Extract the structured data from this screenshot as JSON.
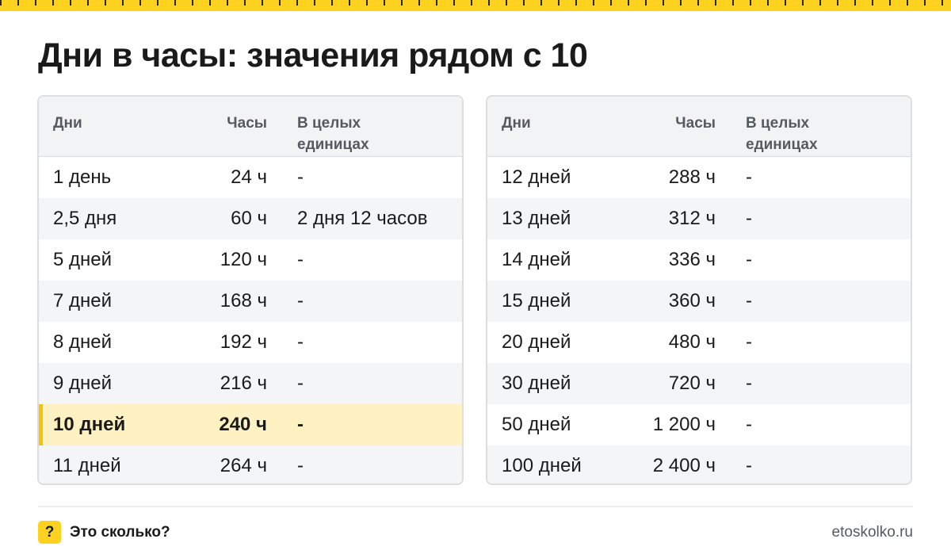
{
  "title": "Дни в часы: значения рядом с 10",
  "columns": {
    "days": "Дни",
    "hours": "Часы",
    "units_line1": "В целых",
    "units_line2": "единицах"
  },
  "left_rows": [
    {
      "days": "1 день",
      "hours": "24 ч",
      "units": "-"
    },
    {
      "days": "2,5 дня",
      "hours": "60 ч",
      "units": "2 дня 12 часов"
    },
    {
      "days": "5 дней",
      "hours": "120 ч",
      "units": "-"
    },
    {
      "days": "7 дней",
      "hours": "168 ч",
      "units": "-"
    },
    {
      "days": "8 дней",
      "hours": "192 ч",
      "units": "-"
    },
    {
      "days": "9 дней",
      "hours": "216 ч",
      "units": "-"
    },
    {
      "days": "10 дней",
      "hours": "240 ч",
      "units": "-"
    },
    {
      "days": "11 дней",
      "hours": "264 ч",
      "units": "-"
    }
  ],
  "right_rows": [
    {
      "days": "12 дней",
      "hours": "288 ч",
      "units": "-"
    },
    {
      "days": "13 дней",
      "hours": "312 ч",
      "units": "-"
    },
    {
      "days": "14 дней",
      "hours": "336 ч",
      "units": "-"
    },
    {
      "days": "15 дней",
      "hours": "360 ч",
      "units": "-"
    },
    {
      "days": "20 дней",
      "hours": "480 ч",
      "units": "-"
    },
    {
      "days": "30 дней",
      "hours": "720 ч",
      "units": "-"
    },
    {
      "days": "50 дней",
      "hours": "1 200 ч",
      "units": "-"
    },
    {
      "days": "100 дней",
      "hours": "2 400 ч",
      "units": "-"
    }
  ],
  "highlighted_row": "10 дней",
  "footer": {
    "badge_icon": "question-mark-icon",
    "badge_glyph": "?",
    "brand": "Это сколько?",
    "site": "etoskolko.ru"
  },
  "colors": {
    "accent": "#ffd21f",
    "highlight": "#fff2c2",
    "header_bg": "#f2f3f5",
    "alt_row": "#f4f5f7"
  }
}
